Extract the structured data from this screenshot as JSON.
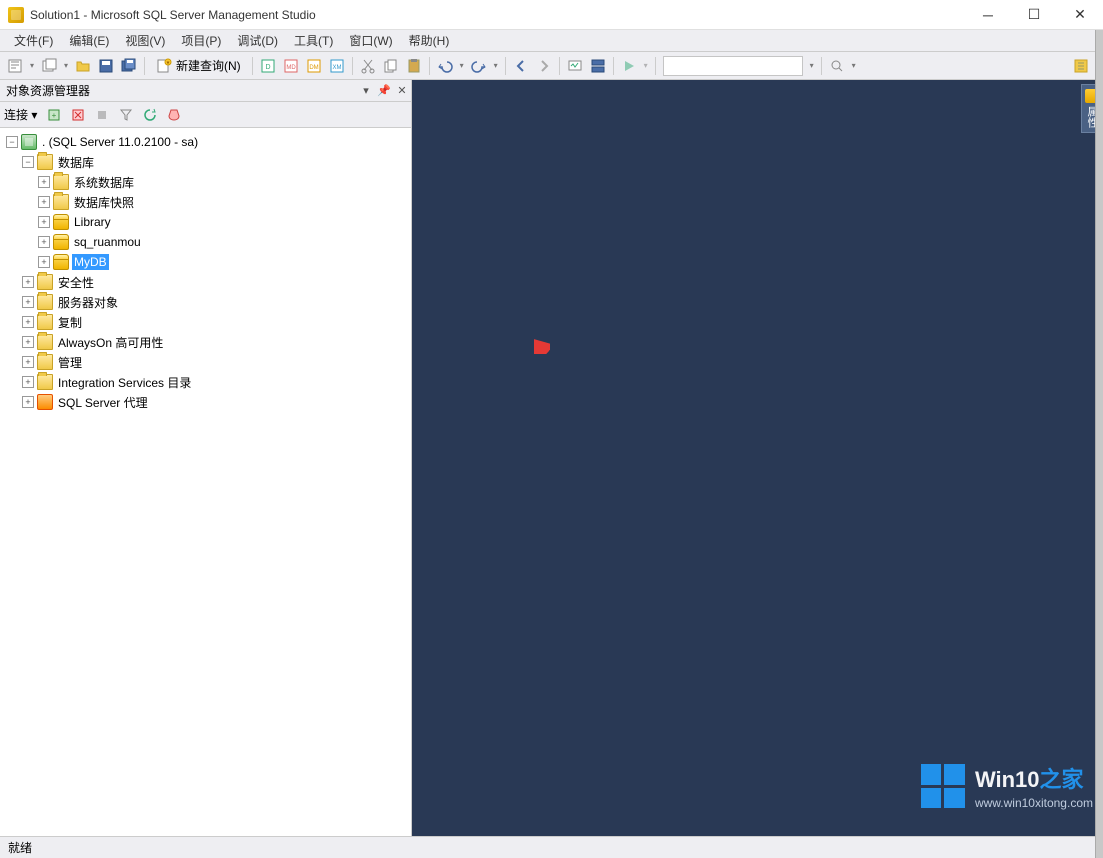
{
  "titlebar": {
    "title": "Solution1 - Microsoft SQL Server Management Studio"
  },
  "menu": [
    "文件(F)",
    "编辑(E)",
    "视图(V)",
    "项目(P)",
    "调试(D)",
    "工具(T)",
    "窗口(W)",
    "帮助(H)"
  ],
  "toolbar": {
    "new_query": "新建查询(N)"
  },
  "panel": {
    "title": "对象资源管理器",
    "connect_label": "连接 ▾"
  },
  "tree": {
    "server": ". (SQL Server 11.0.2100 - sa)",
    "databases": "数据库",
    "system_databases": "系统数据库",
    "database_snapshots": "数据库快照",
    "library": "Library",
    "sq_ruanmou": "sq_ruanmou",
    "mydb": "MyDB",
    "security": "安全性",
    "server_objects": "服务器对象",
    "replication": "复制",
    "alwayson": "AlwaysOn 高可用性",
    "management": "管理",
    "is_catalog": "Integration Services 目录",
    "sql_agent": "SQL Server 代理"
  },
  "sidebar_tab": "属性",
  "statusbar": {
    "ready": "就绪"
  },
  "watermark": {
    "brand_prefix": "Win10",
    "brand_suffix": "之家",
    "url": "www.win10xitong.com"
  }
}
